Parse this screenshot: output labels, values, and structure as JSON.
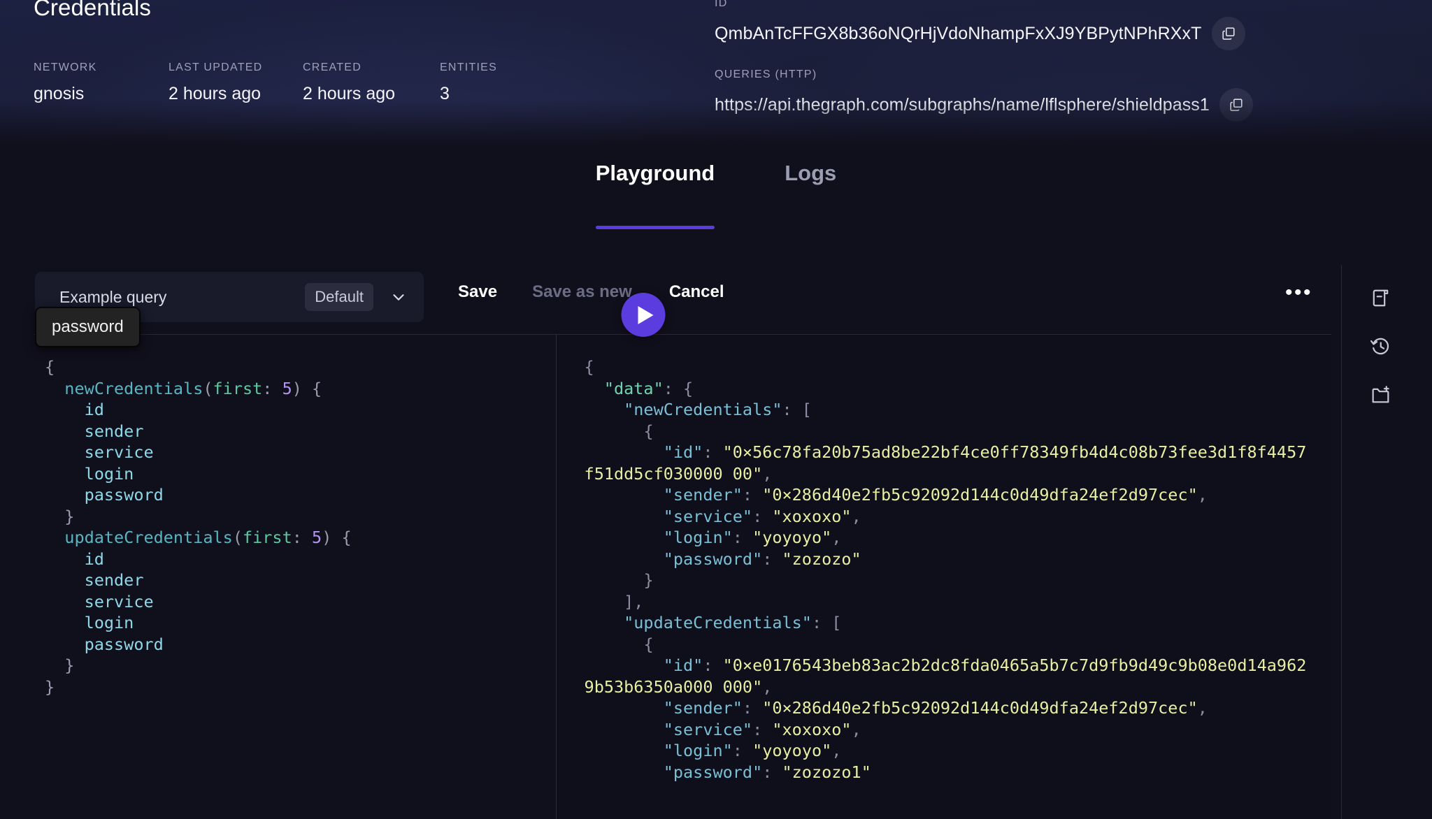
{
  "header": {
    "title": "Credentials",
    "meta": [
      {
        "label": "NETWORK",
        "value": "gnosis"
      },
      {
        "label": "LAST UPDATED",
        "value": "2 hours ago"
      },
      {
        "label": "CREATED",
        "value": "2 hours ago"
      },
      {
        "label": "ENTITIES",
        "value": "3"
      }
    ],
    "id_label": "ID",
    "id_value": "QmbAnTcFFGX8b36oNQrHjVdoNhampFxXJ9YBPytNPhRXxT",
    "queries_label": "QUERIES (HTTP)",
    "queries_value": "https://api.thegraph.com/subgraphs/name/lflsphere/shieldpass1",
    "copy_icon": "copy-icon"
  },
  "tabs": [
    {
      "label": "Playground",
      "active": true
    },
    {
      "label": "Logs",
      "active": false
    }
  ],
  "toolbar": {
    "query_name": "Example query",
    "query_badge": "Default",
    "chevron_icon": "chevron-down-icon",
    "save_label": "Save",
    "save_as_new_label": "Save as new",
    "cancel_label": "Cancel",
    "more_label": "•••",
    "run_icon": "play-icon"
  },
  "editor": {
    "autocomplete_suggestion": "password",
    "query_lines": [
      [
        {
          "t": "punc",
          "s": "{"
        }
      ],
      [
        {
          "t": "punc",
          "s": "  "
        },
        {
          "t": "field",
          "s": "newCredentials"
        },
        {
          "t": "punc",
          "s": "("
        },
        {
          "t": "arg",
          "s": "first"
        },
        {
          "t": "punc",
          "s": ": "
        },
        {
          "t": "num",
          "s": "5"
        },
        {
          "t": "punc",
          "s": ") {"
        }
      ],
      [
        {
          "t": "name",
          "s": "    id"
        }
      ],
      [
        {
          "t": "name",
          "s": "    sender"
        }
      ],
      [
        {
          "t": "name",
          "s": "    service"
        }
      ],
      [
        {
          "t": "name",
          "s": "    login"
        }
      ],
      [
        {
          "t": "name",
          "s": "    password"
        }
      ],
      [
        {
          "t": "punc",
          "s": "  }"
        }
      ],
      [
        {
          "t": "punc",
          "s": "  "
        },
        {
          "t": "field",
          "s": "updateCredentials"
        },
        {
          "t": "punc",
          "s": "("
        },
        {
          "t": "arg",
          "s": "first"
        },
        {
          "t": "punc",
          "s": ": "
        },
        {
          "t": "num",
          "s": "5"
        },
        {
          "t": "punc",
          "s": ") {"
        }
      ],
      [
        {
          "t": "name",
          "s": "    id"
        }
      ],
      [
        {
          "t": "name",
          "s": "    sender"
        }
      ],
      [
        {
          "t": "name",
          "s": "    service"
        }
      ],
      [
        {
          "t": "name",
          "s": "    login"
        }
      ],
      [
        {
          "t": "name",
          "s": "    password"
        }
      ],
      [
        {
          "t": "punc",
          "s": "  }"
        }
      ],
      [
        {
          "t": "punc",
          "s": "}"
        }
      ]
    ],
    "result_lines": [
      [
        {
          "t": "brace",
          "s": "{"
        }
      ],
      [
        {
          "t": "brace",
          "s": "  "
        },
        {
          "t": "key",
          "s": "\"data\""
        },
        {
          "t": "brace",
          "s": ": {"
        }
      ],
      [
        {
          "t": "brace",
          "s": "    "
        },
        {
          "t": "jkey",
          "s": "\"newCredentials\""
        },
        {
          "t": "brace",
          "s": ": ["
        }
      ],
      [
        {
          "t": "brace",
          "s": "      {"
        }
      ],
      [
        {
          "t": "brace",
          "s": "        "
        },
        {
          "t": "jkey",
          "s": "\"id\""
        },
        {
          "t": "brace",
          "s": ": "
        },
        {
          "t": "str",
          "s": "\"0×56c78fa20b75ad8be22bf4ce0ff78349fb4d4c08b73fee3d1f8f4457f51dd5cf030000 00\""
        },
        {
          "t": "brace",
          "s": ","
        }
      ],
      [
        {
          "t": "brace",
          "s": "        "
        },
        {
          "t": "jkey",
          "s": "\"sender\""
        },
        {
          "t": "brace",
          "s": ": "
        },
        {
          "t": "str",
          "s": "\"0×286d40e2fb5c92092d144c0d49dfa24ef2d97cec\""
        },
        {
          "t": "brace",
          "s": ","
        }
      ],
      [
        {
          "t": "brace",
          "s": "        "
        },
        {
          "t": "jkey",
          "s": "\"service\""
        },
        {
          "t": "brace",
          "s": ": "
        },
        {
          "t": "str",
          "s": "\"xoxoxo\""
        },
        {
          "t": "brace",
          "s": ","
        }
      ],
      [
        {
          "t": "brace",
          "s": "        "
        },
        {
          "t": "jkey",
          "s": "\"login\""
        },
        {
          "t": "brace",
          "s": ": "
        },
        {
          "t": "str",
          "s": "\"yoyoyo\""
        },
        {
          "t": "brace",
          "s": ","
        }
      ],
      [
        {
          "t": "brace",
          "s": "        "
        },
        {
          "t": "jkey",
          "s": "\"password\""
        },
        {
          "t": "brace",
          "s": ": "
        },
        {
          "t": "str",
          "s": "\"zozozo\""
        }
      ],
      [
        {
          "t": "brace",
          "s": "      }"
        }
      ],
      [
        {
          "t": "brace",
          "s": "    ],"
        }
      ],
      [
        {
          "t": "brace",
          "s": "    "
        },
        {
          "t": "jkey",
          "s": "\"updateCredentials\""
        },
        {
          "t": "brace",
          "s": ": ["
        }
      ],
      [
        {
          "t": "brace",
          "s": "      {"
        }
      ],
      [
        {
          "t": "brace",
          "s": "        "
        },
        {
          "t": "jkey",
          "s": "\"id\""
        },
        {
          "t": "brace",
          "s": ": "
        },
        {
          "t": "str",
          "s": "\"0×e0176543beb83ac2b2dc8fda0465a5b7c7d9fb9d49c9b08e0d14a9629b53b6350a000 000\""
        },
        {
          "t": "brace",
          "s": ","
        }
      ],
      [
        {
          "t": "brace",
          "s": "        "
        },
        {
          "t": "jkey",
          "s": "\"sender\""
        },
        {
          "t": "brace",
          "s": ": "
        },
        {
          "t": "str",
          "s": "\"0×286d40e2fb5c92092d144c0d49dfa24ef2d97cec\""
        },
        {
          "t": "brace",
          "s": ","
        }
      ],
      [
        {
          "t": "brace",
          "s": "        "
        },
        {
          "t": "jkey",
          "s": "\"service\""
        },
        {
          "t": "brace",
          "s": ": "
        },
        {
          "t": "str",
          "s": "\"xoxoxo\""
        },
        {
          "t": "brace",
          "s": ","
        }
      ],
      [
        {
          "t": "brace",
          "s": "        "
        },
        {
          "t": "jkey",
          "s": "\"login\""
        },
        {
          "t": "brace",
          "s": ": "
        },
        {
          "t": "str",
          "s": "\"yoyoyo\""
        },
        {
          "t": "brace",
          "s": ","
        }
      ],
      [
        {
          "t": "brace",
          "s": "        "
        },
        {
          "t": "jkey",
          "s": "\"password\""
        },
        {
          "t": "brace",
          "s": ": "
        },
        {
          "t": "str",
          "s": "\"zozozo1\""
        }
      ]
    ]
  },
  "rail": [
    {
      "icon": "docs-book-icon"
    },
    {
      "icon": "history-clock-icon"
    },
    {
      "icon": "new-folder-icon"
    }
  ],
  "colors": {
    "accent": "#5b3ddf",
    "background": "#100f1c",
    "header_gradient_top": "#1d2141",
    "text_primary": "#f4f5fb",
    "text_muted": "#9ea0b9",
    "string_token": "#e8efa3",
    "key_token": "#79c0d6"
  }
}
